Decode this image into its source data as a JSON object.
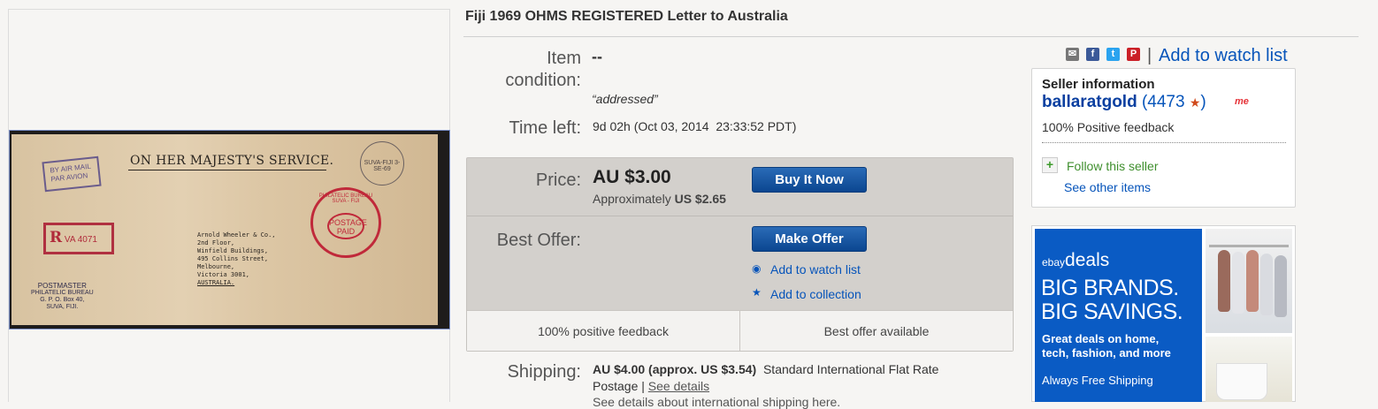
{
  "listing": {
    "title": "Fiji 1969 OHMS REGISTERED Letter to Australia"
  },
  "image": {
    "envelope_header": "ON HER MAJESTY'S SERVICE.",
    "airmail_stamp": "BY AIR MAIL PAR AVION",
    "registered_mark": "R",
    "registered_text": "VA",
    "registered_number": "4071",
    "postage_stamp_outer": "PHILATELIC BUREAU SUVA - FIJI",
    "postage_stamp_inner": "POSTAGE PAID",
    "postmark": "SUVA-FIJI 3-SE-69",
    "address_lines": [
      "Arnold Wheeler & Co.,",
      "2nd Floor,",
      "Winfield Buildings,",
      "495 Collins Street,",
      "Melbourne,",
      "Victoria 3001,",
      "AUSTRALIA."
    ],
    "sender_lines": [
      "POSTMASTER",
      "PHILATELIC BUREAU",
      "G. P. O. Box 40,",
      "SUVA, FIJI."
    ]
  },
  "details": {
    "condition_label": "Item condition:",
    "condition_value": "--",
    "condition_note": "“addressed”",
    "time_label": "Time left:",
    "time_value": "9d 02h (Oct 03, 2014  23:33:52 PDT)"
  },
  "buy_box": {
    "price_label": "Price:",
    "price_value": "AU $3.00",
    "approx_prefix": "Approximately",
    "approx_value": "US $2.65",
    "buy_now_label": "Buy It Now",
    "best_offer_label": "Best Offer:",
    "make_offer_label": "Make Offer",
    "watch_link": "Add to watch list",
    "collection_link": "Add to collection",
    "feature_1": "100% positive feedback",
    "feature_2": "Best offer available"
  },
  "shipping": {
    "label": "Shipping:",
    "cost": "AU $4.00 (approx. US $3.54)",
    "service": "Standard International Flat Rate",
    "service_2": "Postage",
    "separator": "|",
    "details_link": "See details",
    "note": "See details about international shipping here."
  },
  "share": {
    "icons": [
      "mail-icon",
      "facebook-icon",
      "twitter-icon",
      "pinterest-icon"
    ],
    "separator": "|",
    "watch_link": "Add to watch list"
  },
  "seller": {
    "heading": "Seller information",
    "name": "ballaratgold",
    "score_open": "(",
    "score": "4473",
    "score_close": ")",
    "me_badge": "me",
    "feedback": "100% Positive feedback",
    "follow_label": "Follow this seller",
    "other_items_label": "See other items"
  },
  "ad": {
    "brand_prefix": "ebay",
    "brand_word": "deals",
    "headline_1": "BIG BRANDS.",
    "headline_2": "BIG SAVINGS.",
    "sub_1": "Great deals on home,",
    "sub_2": "tech, fashion, and more",
    "free_shipping": "Always Free Shipping"
  },
  "colors": {
    "link_blue": "#0654ba",
    "button_blue": "#0b4690",
    "ad_blue": "#0a5bc4",
    "follow_green": "#3f8f2e",
    "star_orange": "#d04a1c"
  }
}
